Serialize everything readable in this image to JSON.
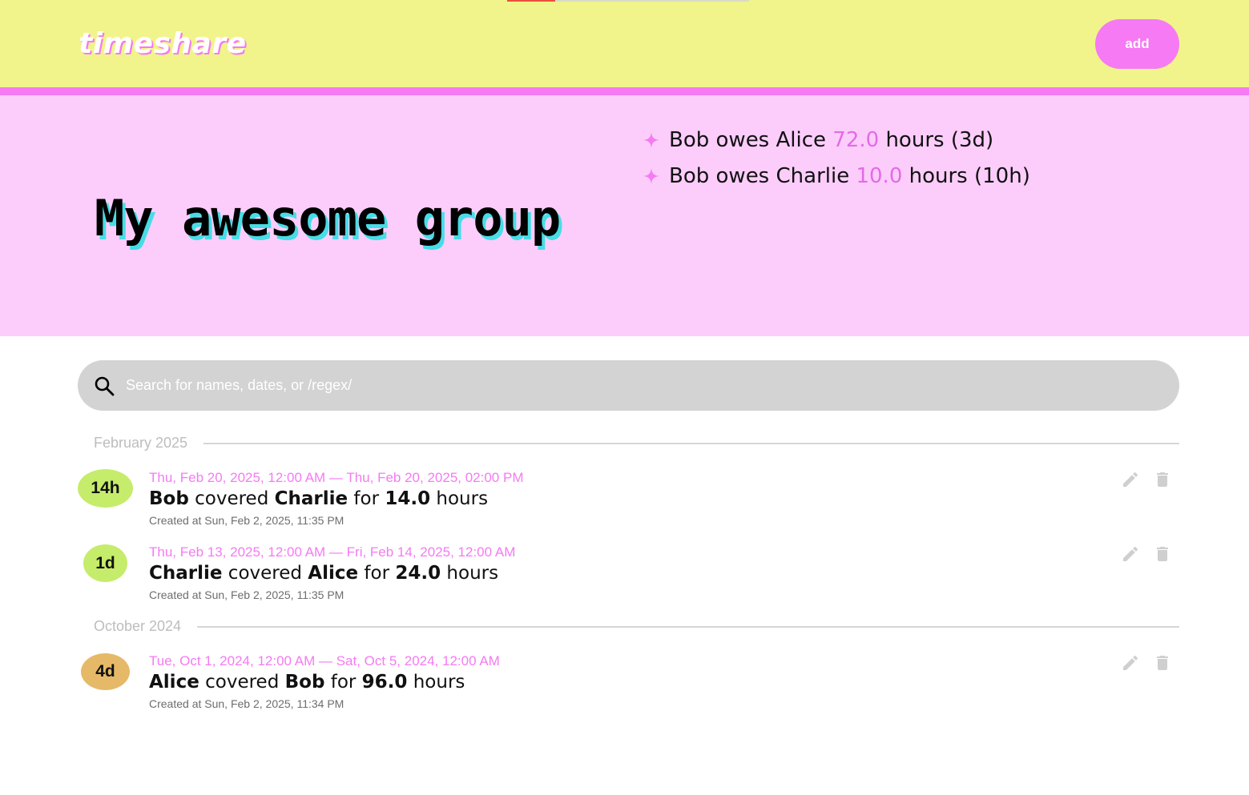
{
  "app": {
    "logo": "timeshare",
    "add_label": "add"
  },
  "colors": {
    "header_bg": "#f1f48a",
    "accent_pink": "#f57af3",
    "hero_bg": "#fccdfb",
    "title_shadow": "#48dce6",
    "badge_green": "#c5ec6a",
    "badge_gold": "#e6b968"
  },
  "group": {
    "title": "My awesome group"
  },
  "debts": [
    {
      "icon": "sparkle-icon",
      "debtor": "Bob",
      "owes": "owes",
      "creditor": "Alice",
      "amount": "72.0",
      "unit": "hours",
      "short": "(3d)"
    },
    {
      "icon": "sparkle-icon",
      "debtor": "Bob",
      "owes": "owes",
      "creditor": "Charlie",
      "amount": "10.0",
      "unit": "hours",
      "short": "(10h)"
    }
  ],
  "search": {
    "icon": "search-icon",
    "placeholder": "Search for names, dates, or /regex/"
  },
  "months": [
    {
      "label": "February 2025",
      "entries": [
        {
          "badge": "14h",
          "range": "Thu, Feb 20, 2025, 12:00 AM — Thu, Feb 20, 2025, 02:00 PM",
          "coverer": "Bob",
          "covered_word": "covered",
          "covered": "Charlie",
          "for_word": "for",
          "hours": "14.0",
          "unit": "hours",
          "created": "Created at Sun, Feb 2, 2025, 11:35 PM"
        },
        {
          "badge": "1d",
          "range": "Thu, Feb 13, 2025, 12:00 AM — Fri, Feb 14, 2025, 12:00 AM",
          "coverer": "Charlie",
          "covered_word": "covered",
          "covered": "Alice",
          "for_word": "for",
          "hours": "24.0",
          "unit": "hours",
          "created": "Created at Sun, Feb 2, 2025, 11:35 PM"
        }
      ]
    },
    {
      "label": "October 2024",
      "entries": [
        {
          "badge": "4d",
          "range": "Tue, Oct 1, 2024, 12:00 AM — Sat, Oct 5, 2024, 12:00 AM",
          "coverer": "Alice",
          "covered_word": "covered",
          "covered": "Bob",
          "for_word": "for",
          "hours": "96.0",
          "unit": "hours",
          "created": "Created at Sun, Feb 2, 2025, 11:34 PM"
        }
      ]
    }
  ],
  "actions": {
    "edit_icon": "edit-icon",
    "delete_icon": "trash-icon"
  }
}
